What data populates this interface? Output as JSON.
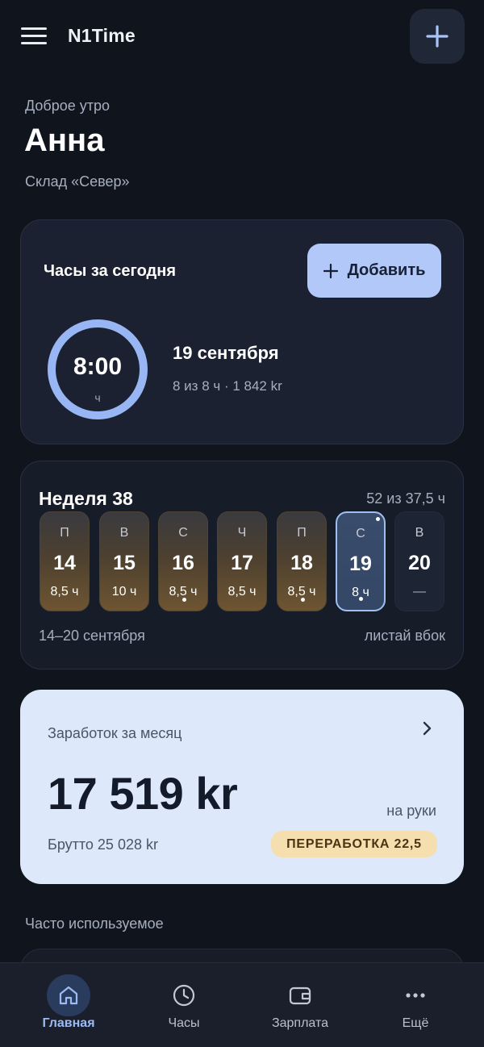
{
  "app": {
    "title": "N1Time"
  },
  "header": {
    "menu_icon": "hamburger-icon",
    "add_icon": "plus-icon"
  },
  "greeting": {
    "salutation": "Доброе утро",
    "name": "Анна",
    "workplace": "Склад «Север»"
  },
  "today": {
    "title": "Часы за сегодня",
    "add_label": "Добавить",
    "time": "8:00",
    "unit": "ч",
    "progress": 1.0,
    "date": "19 сентября",
    "detail": "8 из 8 ч · 1 842 kr",
    "ring_color": "#97b6f3"
  },
  "week": {
    "title": "Неделя 38",
    "total": "52 из 37,5 ч",
    "range": "14–20 сентября",
    "hint": "листай вбок",
    "days": [
      {
        "dow": "П",
        "num": "14",
        "hours": "8,5 ч"
      },
      {
        "dow": "В",
        "num": "15",
        "hours": "10 ч"
      },
      {
        "dow": "С",
        "num": "16",
        "hours": "8,5 ч"
      },
      {
        "dow": "Ч",
        "num": "17",
        "hours": "8,5 ч"
      },
      {
        "dow": "П",
        "num": "18",
        "hours": "8,5 ч"
      },
      {
        "dow": "С",
        "num": "19",
        "hours": "8 ч"
      },
      {
        "dow": "В",
        "num": "20",
        "hours": "—"
      }
    ]
  },
  "earnings": {
    "title": "Заработок за месяц",
    "amount": "17 519 kr",
    "net_label": "на руки",
    "gross": "Брутто 25 028 kr",
    "overtime": "ПЕРЕРАБОТКА 22,5"
  },
  "frequent": {
    "title": "Часто используемое"
  },
  "nav": {
    "items": [
      {
        "label": "Главная",
        "icon": "home-icon"
      },
      {
        "label": "Часы",
        "icon": "clock-icon"
      },
      {
        "label": "Зарплата",
        "icon": "wallet-icon"
      },
      {
        "label": "Ещё",
        "icon": "more-icon"
      }
    ]
  },
  "colors": {
    "background": "#10141c",
    "accent": "#b1c8f8",
    "earnings_card": "#dde8fa",
    "overtime_badge": "#f5dfae"
  }
}
